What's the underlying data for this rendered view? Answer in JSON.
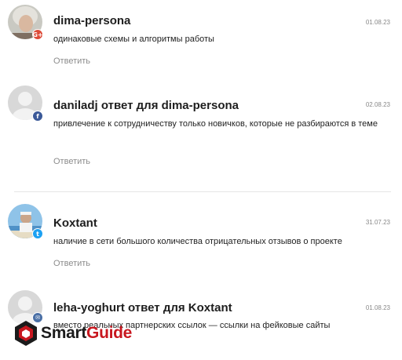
{
  "comments": [
    {
      "author": "dima-persona",
      "date": "01.08.23",
      "text": "одинаковые схемы и алгоритмы работы",
      "reply_label": "Ответить",
      "badge": "G+"
    },
    {
      "author": "daniladj ответ для dima-persona",
      "date": "02.08.23",
      "text": "привлечение к сотрудничеству только новичков, которые не разбираются в теме",
      "reply_label": "Ответить",
      "badge": "f"
    },
    {
      "author": "Koxtant",
      "date": "31.07.23",
      "text": "наличие в сети большого количества отрицательных отзывов о проекте",
      "reply_label": "Ответить",
      "badge": "t"
    },
    {
      "author": "leha-yoghurt ответ для Koxtant",
      "date": "01.08.23",
      "text": "вместо реальных партнерских ссылок — ссылки на фейковые сайты",
      "reply_label": "",
      "badge": "✉"
    }
  ],
  "watermark": {
    "smart": "Smart",
    "guide": "Guide"
  },
  "colors": {
    "google_badge": "#dd4b39",
    "facebook_badge": "#3b5998",
    "twitter_badge": "#1da1f2",
    "mail_badge": "#4a6fa5",
    "brand_red": "#c8171f"
  }
}
